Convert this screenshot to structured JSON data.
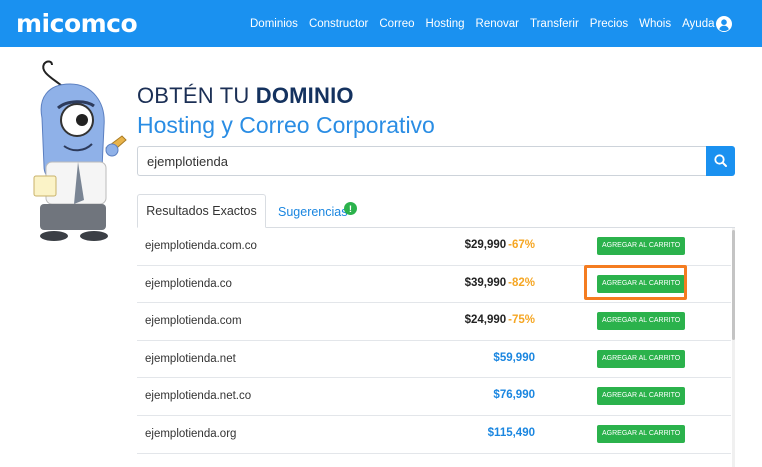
{
  "header": {
    "logo": "micomco",
    "nav": [
      "Dominios",
      "Constructor",
      "Correo",
      "Hosting",
      "Renovar",
      "Transferir",
      "Precios",
      "Whois",
      "Ayuda"
    ],
    "user_icon": "user-circle-icon",
    "bg_color": "#1a91f0"
  },
  "hero": {
    "title_prefix": "OBTÉN TU ",
    "title_bold": "DOMINIO",
    "subtitle": "Hosting y Correo Corporativo"
  },
  "search": {
    "value": "ejemplotienda",
    "icon": "search-icon"
  },
  "tabs": [
    {
      "label": "Resultados Exactos",
      "active": true
    },
    {
      "label": "Sugerencias",
      "active": false,
      "badge": "!"
    }
  ],
  "results": [
    {
      "domain": "ejemplotienda.com.co",
      "price": "$29,990",
      "discount": "-67%"
    },
    {
      "domain": "ejemplotienda.co",
      "price": "$39,990",
      "discount": "-82%"
    },
    {
      "domain": "ejemplotienda.com",
      "price": "$24,990",
      "discount": "-75%"
    },
    {
      "domain": "ejemplotienda.net",
      "price": "$59,990",
      "discount": ""
    },
    {
      "domain": "ejemplotienda.net.co",
      "price": "$76,990",
      "discount": ""
    },
    {
      "domain": "ejemplotienda.org",
      "price": "$115,490",
      "discount": ""
    }
  ],
  "cart_label": "AGREGAR AL CARRITO",
  "colors": {
    "accent": "#1a91f0",
    "cart": "#2bb24c",
    "discount": "#f5a623",
    "highlight": "#f47c20"
  }
}
